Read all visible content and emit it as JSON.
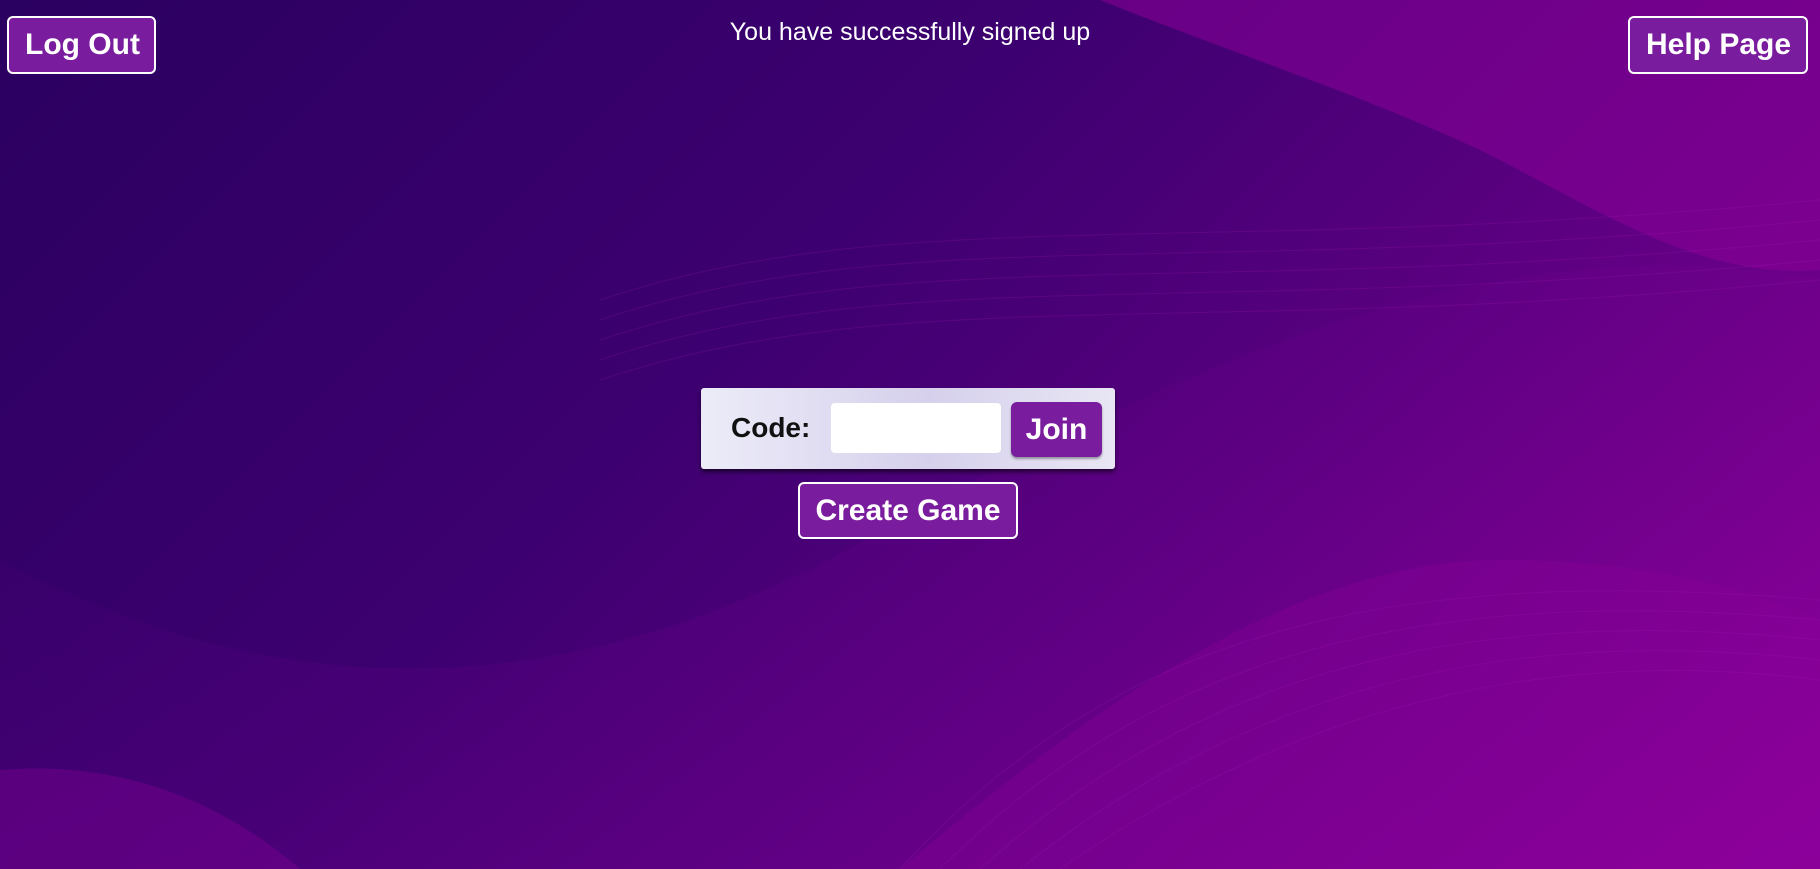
{
  "header": {
    "logout_label": "Log Out",
    "help_label": "Help Page",
    "status_message": "You have successfully signed up"
  },
  "join": {
    "code_label": "Code:",
    "code_value": "",
    "join_label": "Join"
  },
  "actions": {
    "create_game_label": "Create Game"
  },
  "colors": {
    "button_bg": "#7a1c9e",
    "background_dark": "#2a0060",
    "background_light": "#8a0098"
  }
}
